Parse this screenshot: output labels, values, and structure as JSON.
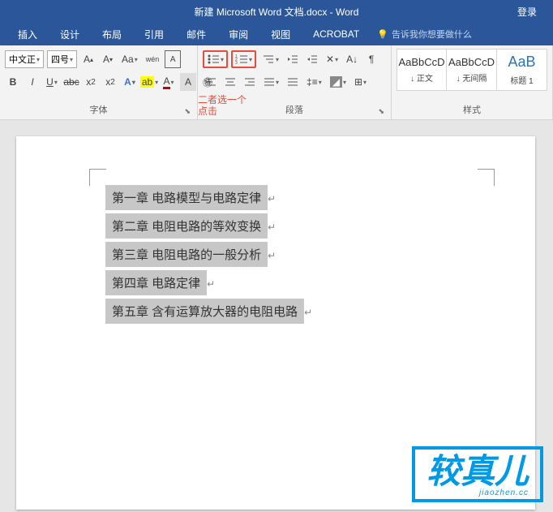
{
  "titlebar": {
    "title": "新建 Microsoft Word 文档.docx  -  Word",
    "login": "登录"
  },
  "tabs": {
    "items": [
      "插入",
      "设计",
      "布局",
      "引用",
      "邮件",
      "审阅",
      "视图",
      "ACROBAT"
    ],
    "tell_me": "告诉我你想要做什么"
  },
  "ribbon": {
    "font": {
      "name_combo": "中文正",
      "size_combo": "四号",
      "label": "字体"
    },
    "paragraph": {
      "label": "段落"
    },
    "styles": {
      "label": "样式",
      "items": [
        {
          "preview": "AaBbCcD",
          "previewChar": "↓",
          "name": "↓ 正文"
        },
        {
          "preview": "AaBbCcD",
          "previewChar": "↓",
          "name": "↓ 无间隔"
        },
        {
          "preview": "AaB",
          "previewChar": "",
          "name": "标题 1"
        }
      ]
    }
  },
  "annotation": "二者选一个点击",
  "document": {
    "lines": [
      "第一章  电路模型与电路定律",
      "第二章  电阻电路的等效变换",
      "第三章  电阻电路的一般分析",
      "第四章  电路定律",
      "第五章  含有运算放大器的电阻电路"
    ]
  },
  "watermark": {
    "text": "较真儿",
    "sub": "jiaozhen.cc"
  }
}
